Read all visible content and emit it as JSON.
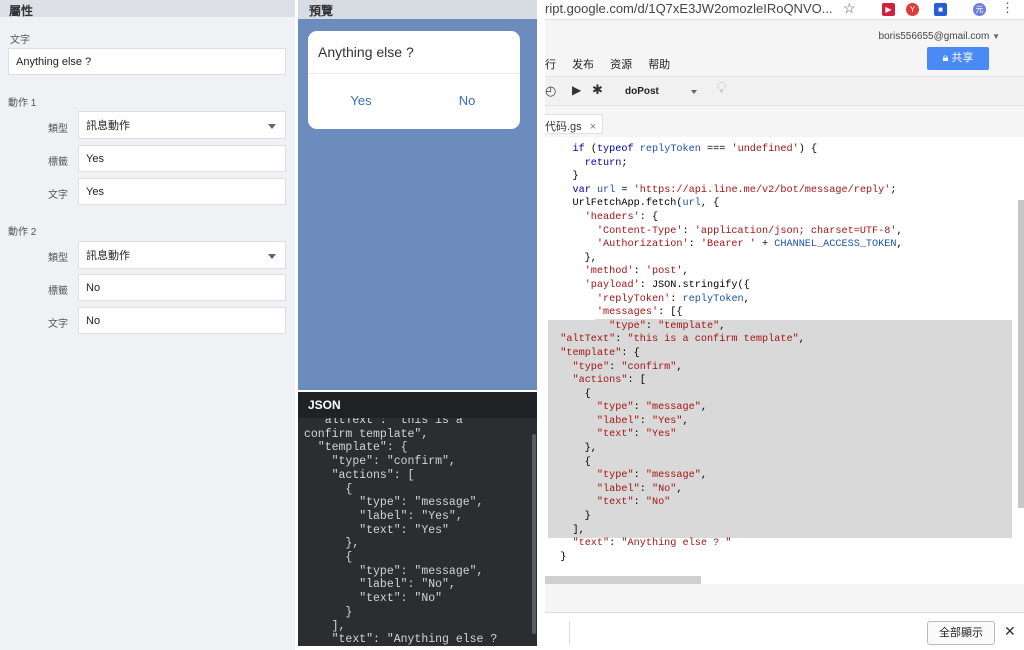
{
  "props": {
    "header": "屬性",
    "text_label": "文字",
    "text_value": "Anything else ?",
    "actions": [
      {
        "title": "動作 1",
        "type_label": "類型",
        "type_value": "訊息動作",
        "label_label": "標籤",
        "label_value": "Yes",
        "text_label": "文字",
        "text_value": "Yes"
      },
      {
        "title": "動作 2",
        "type_label": "類型",
        "type_value": "訊息動作",
        "label_label": "標籤",
        "label_value": "No",
        "text_label": "文字",
        "text_value": "No"
      }
    ]
  },
  "preview": {
    "header": "預覽",
    "question": "Anything else ?",
    "yes": "Yes",
    "no": "No"
  },
  "json_panel": {
    "title": "JSON",
    "text": "  \"altText\": \"this is a\nconfirm template\",\n  \"template\": {\n    \"type\": \"confirm\",\n    \"actions\": [\n      {\n        \"type\": \"message\",\n        \"label\": \"Yes\",\n        \"text\": \"Yes\"\n      },\n      {\n        \"type\": \"message\",\n        \"label\": \"No\",\n        \"text\": \"No\"\n      }\n    ],\n    \"text\": \"Anything else ?"
  },
  "editor": {
    "url": "ript.google.com/d/1Q7xE3JW2omozleIRoQNVO...",
    "account": "boris556655@gmail.com",
    "menus": [
      "行",
      "发布",
      "资源",
      "帮助"
    ],
    "share": "共享",
    "function": "doPost",
    "tab": "代码.gs",
    "show_all": "全部顯示"
  }
}
